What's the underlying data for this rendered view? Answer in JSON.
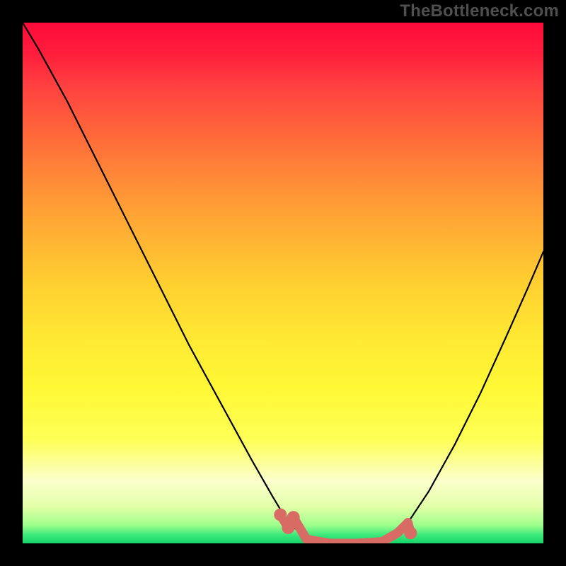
{
  "watermark": {
    "text": "TheBottleneck.com"
  },
  "chart_data": {
    "type": "line",
    "title": "",
    "xlabel": "",
    "ylabel": "",
    "xlim": [
      0,
      1
    ],
    "ylim": [
      0,
      1
    ],
    "series": [
      {
        "name": "bottleneck-curve",
        "color": "#000000",
        "x": [
          0.0,
          0.03,
          0.085,
          0.14,
          0.2,
          0.26,
          0.32,
          0.38,
          0.44,
          0.48,
          0.51,
          0.545,
          0.58,
          0.62,
          0.66,
          0.7,
          0.74,
          0.78,
          0.83,
          0.88,
          0.93,
          0.97,
          1.0
        ],
        "y": [
          1.0,
          0.95,
          0.85,
          0.74,
          0.62,
          0.5,
          0.38,
          0.27,
          0.16,
          0.09,
          0.04,
          0.01,
          0.0,
          0.0,
          0.0,
          0.01,
          0.04,
          0.1,
          0.19,
          0.29,
          0.4,
          0.49,
          0.56
        ]
      }
    ],
    "highlight_segment": {
      "color": "#d86b64",
      "thick": true,
      "x": [
        0.495,
        0.51,
        0.52,
        0.545,
        0.59,
        0.64,
        0.69,
        0.72,
        0.74,
        0.745
      ],
      "y": [
        0.055,
        0.03,
        0.05,
        0.008,
        0.0,
        0.0,
        0.003,
        0.02,
        0.04,
        0.02
      ]
    },
    "highlight_dots": {
      "color": "#d86b64",
      "points": [
        {
          "x": 0.495,
          "y": 0.055
        },
        {
          "x": 0.51,
          "y": 0.03
        },
        {
          "x": 0.52,
          "y": 0.05
        },
        {
          "x": 0.745,
          "y": 0.02
        }
      ]
    }
  }
}
